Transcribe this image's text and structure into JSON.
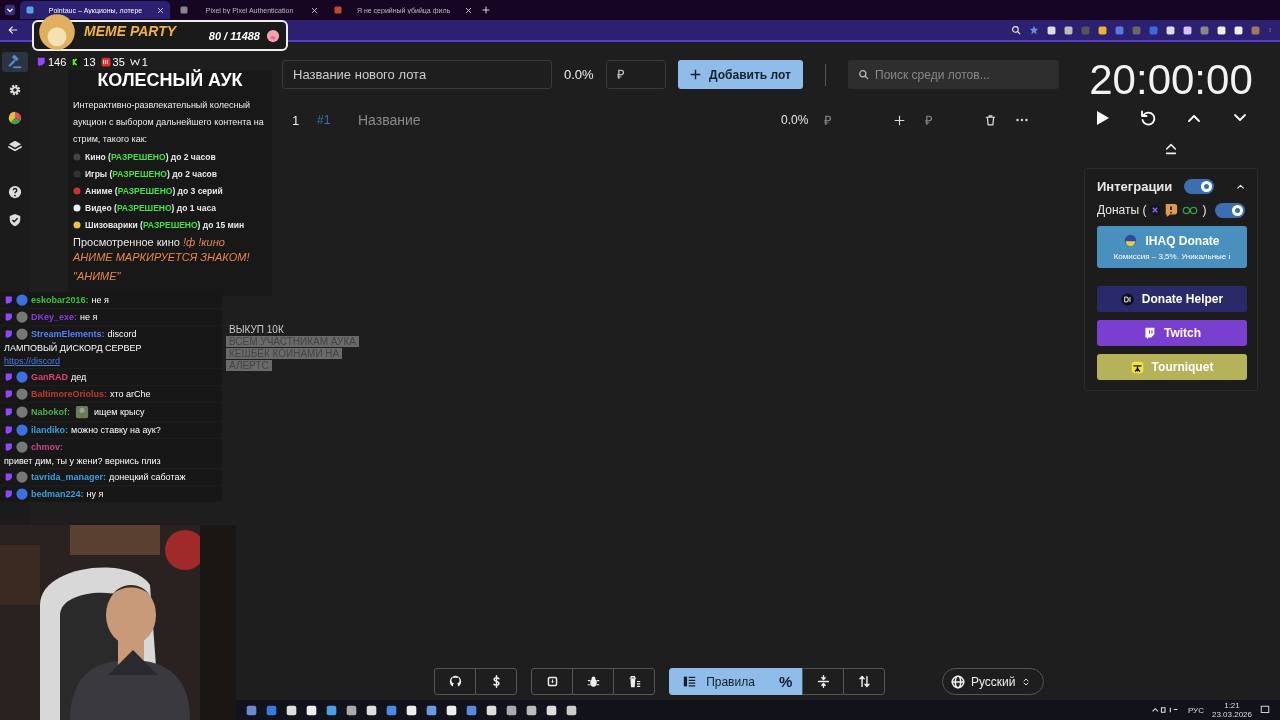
{
  "browser": {
    "tabs": [
      {
        "title": "Pointauc – Аукционы, лотере",
        "selected": true
      },
      {
        "title": "Pixel by Pixel Authentication",
        "selected": false
      },
      {
        "title": "Я не серийный убийца филь",
        "selected": false
      }
    ]
  },
  "sidebar": {
    "items": [
      {
        "kind": "gavel",
        "selected": true
      },
      {
        "kind": "gear",
        "selected": false
      },
      {
        "kind": "pie",
        "selected": false
      },
      {
        "kind": "layers",
        "selected": false
      },
      {
        "kind": "help",
        "selected": false
      },
      {
        "kind": "shield",
        "selected": false
      }
    ]
  },
  "add_lot": {
    "name_placeholder": "Название нового лота",
    "percent": "0.0%",
    "amount_placeholder": "₽",
    "button": "Добавить лот",
    "search_placeholder": "Поиск среди лотов..."
  },
  "lots": [
    {
      "index": "1",
      "id": "#1",
      "name_placeholder": "Название",
      "percent": "0.0%",
      "amount": "₽",
      "add_placeholder": "₽"
    }
  ],
  "timer": {
    "time": "20:00:00"
  },
  "integrations": {
    "title": "Интеграции",
    "on": true,
    "expanded": true,
    "donations_open": "Донаты (",
    "donations_close": ")",
    "donations_on": true,
    "services": [
      {
        "kind": "ihaq",
        "name": "IHAQ Donate",
        "note": "Комиссия – 3,5%. Уникальные і"
      },
      {
        "kind": "donate_helper",
        "name": "Donate Helper"
      },
      {
        "kind": "twitch",
        "name": "Twitch"
      },
      {
        "kind": "tourniquet",
        "name": "Tourniquet"
      }
    ]
  },
  "toolbar": {
    "groups": [
      [
        {
          "kind": "github",
          "selected": false
        },
        {
          "kind": "dollar",
          "selected": false
        }
      ],
      [
        {
          "kind": "save",
          "selected": false
        },
        {
          "kind": "bug",
          "selected": false
        },
        {
          "kind": "clear",
          "selected": false
        }
      ],
      [
        {
          "kind": "rules",
          "label": "Правила",
          "selected": true
        },
        {
          "kind": "percent",
          "label": "%",
          "selected": true
        },
        {
          "kind": "compress",
          "selected": false
        },
        {
          "kind": "sort",
          "selected": false
        }
      ]
    ]
  },
  "language": "Русский",
  "overlay": {
    "meme": {
      "title": "MEME PARTY",
      "count": "80 / 11488"
    },
    "stats": [
      {
        "kind": "twitch",
        "value": "146"
      },
      {
        "kind": "kick",
        "value": "13"
      },
      {
        "kind": "vk",
        "value": "35"
      },
      {
        "kind": "w",
        "value": "1"
      }
    ]
  },
  "rules": {
    "title": "КОЛЕСНЫЙ АУК",
    "intro": "Интерактивно-развлекательный колесный аукцион с выбором дальнейшего контента на стрим, такого как:",
    "items": [
      {
        "kind": "film",
        "before": "Кино (",
        "status": "РАЗРЕШЕНО",
        "after": ") до 2 часов"
      },
      {
        "kind": "game",
        "before": "Игры (",
        "status": "РАЗРЕШЕНО",
        "after": ") до 2 часов"
      },
      {
        "kind": "devil",
        "before": "Аниме (",
        "status": "РАЗРЕШЕНО",
        "after": ") до 3 серий"
      },
      {
        "kind": "video",
        "before": "Видео (",
        "status": "РАЗРЕШЕНО",
        "after": ") до 1 часа"
      },
      {
        "kind": "smile",
        "before": "Шизоварики (",
        "status": "РАЗРЕШЕНО",
        "after": ") до 15 мин"
      }
    ],
    "watched": "Просмотренное кино",
    "commands": "!ф !кино",
    "notes": [
      "АНИМЕ МАРКИРУЕТСЯ ЗНАКОМ!",
      "\"АНИМЕ\""
    ]
  },
  "chat": [
    {
      "name": "eskobar2016:",
      "color": "#3fbf3f",
      "text": "не я"
    },
    {
      "name": "DKey_exe:",
      "color": "#8a3be2",
      "text": "не я"
    },
    {
      "name": "StreamElements:",
      "color": "#5a7fff",
      "text": "discord",
      "line": "ЛАМПОВЫЙ ДИСКОРД СЕРВЕР",
      "link": "https://discord"
    },
    {
      "name": "GanRAD",
      "color": "#e0407a",
      "text": "дед"
    },
    {
      "name": "BaltimoreOriolus:",
      "color": "#c0392b",
      "text": "хто arChe"
    },
    {
      "name": "Nabokof:",
      "color": "#4caf50",
      "text": "ищем крысу",
      "emote": true
    },
    {
      "name": "ilandiko:",
      "color": "#3aa0e0",
      "text": "можно ставку на аук?"
    },
    {
      "name": "chmov:",
      "color": "#c04a8a",
      "text": "привет дим, ты у жени? вернись плиз"
    },
    {
      "name": "tavrida_manager:",
      "color": "#3aa0e0",
      "text": "донецкий саботаж"
    },
    {
      "name": "bedman224:",
      "color": "#3aa0e0",
      "text": "ну я"
    }
  ],
  "alert_overlay": [
    "ВЫКУП 10К",
    "ВСЕМ УЧАСТНИКАМ АУКА",
    "КЕШБЕК КОИНАМИ НА",
    "АЛЕРТС"
  ],
  "webcam": {
    "kind": "picture"
  },
  "taskbar": {
    "lang": "РУС",
    "time": "1:21",
    "date": "23.03.2026"
  }
}
